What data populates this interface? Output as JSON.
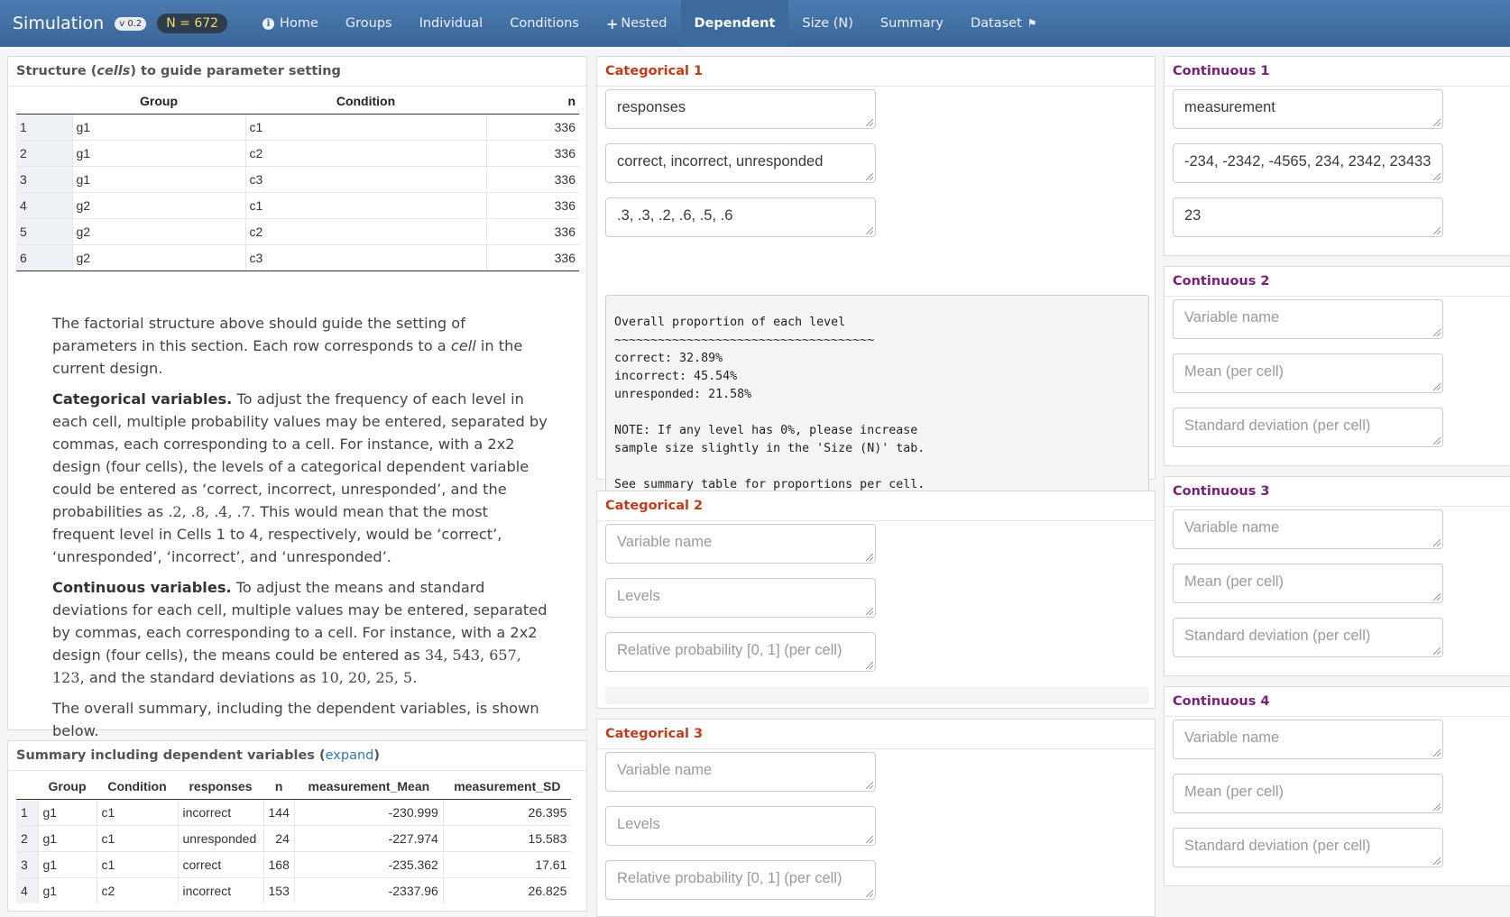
{
  "nav": {
    "brand": "Simulation",
    "version": "v 0.2",
    "n_badge": "N = 672",
    "items": [
      "Home",
      "Groups",
      "Individual",
      "Conditions",
      "Nested",
      "Dependent",
      "Size (N)",
      "Summary",
      "Dataset"
    ],
    "active": "Dependent"
  },
  "structure": {
    "title_pre": "Structure (",
    "title_em": "cells",
    "title_post": ") to guide parameter setting",
    "headers": [
      "Group",
      "Condition",
      "n"
    ],
    "rows": [
      [
        "1",
        "g1",
        "c1",
        "336"
      ],
      [
        "2",
        "g1",
        "c2",
        "336"
      ],
      [
        "3",
        "g1",
        "c3",
        "336"
      ],
      [
        "4",
        "g2",
        "c1",
        "336"
      ],
      [
        "5",
        "g2",
        "c2",
        "336"
      ],
      [
        "6",
        "g2",
        "c3",
        "336"
      ]
    ],
    "p1_a": "The factorial structure above should guide the setting of parameters in this section. Each row corresponds to a ",
    "p1_em": "cell",
    "p1_b": " in the current design.",
    "p2_bold": "Categorical variables.",
    "p2_a": " To adjust the frequency of each level in each cell, multiple probability values may be entered, separated by commas, each corresponding to a cell. For instance, with a 2x2 design (four cells), the levels of a categorical dependent variable could be entered as ‘correct, incorrect, unresponded’, and the probabilities as ",
    "p2_math": ".2, .8, .4, .7",
    "p2_b": ". This would mean that the most frequent level in Cells 1 to 4, respectively, would be ‘correct’, ‘unresponded’, ‘incorrect’, and ‘unresponded’.",
    "p3_bold": "Continuous variables.",
    "p3_a": " To adjust the means and standard deviations for each cell, multiple values may be entered, separated by commas, each corresponding to a cell. For instance, with a 2x2 design (four cells), the means could be entered as ",
    "p3_math1": "34, 543, 657, 123",
    "p3_b": ", and the standard deviations as ",
    "p3_math2": "10, 20, 25, 5",
    "p3_c": ".",
    "p4": "The overall summary, including the dependent variables, is shown below."
  },
  "summary": {
    "title": "Summary including dependent variables",
    "link_open": " (",
    "link": "expand",
    "link_close": ")",
    "headers": [
      "Group",
      "Condition",
      "responses",
      "n",
      "measurement_Mean",
      "measurement_SD"
    ],
    "rows": [
      [
        "1",
        "g1",
        "c1",
        "incorrect",
        "144",
        "-230.999",
        "26.395"
      ],
      [
        "2",
        "g1",
        "c1",
        "unresponded",
        "24",
        "-227.974",
        "15.583"
      ],
      [
        "3",
        "g1",
        "c1",
        "correct",
        "168",
        "-235.362",
        "17.61"
      ],
      [
        "4",
        "g1",
        "c2",
        "incorrect",
        "153",
        "-2337.96",
        "26.825"
      ]
    ]
  },
  "categorical": [
    {
      "title": "Categorical 1",
      "name": "responses",
      "levels": "correct, incorrect, unresponded",
      "probs": ".3, .3, .2, .6, .5, .6",
      "output": "Overall proportion of each level\n~~~~~~~~~~~~~~~~~~~~~~~~~~~~~~~~~~~~\ncorrect: 32.89%\nincorrect: 45.54%\nunresponded: 21.58%\n\nNOTE: If any level has 0%, please increase\nsample size slightly in the 'Size (N)' tab.\n\nSee summary table for proportions per cell.\n_"
    },
    {
      "title": "Categorical 2",
      "ph_name": "Variable name",
      "ph_levels": "Levels",
      "ph_probs": "Relative probability [0, 1] (per cell)"
    },
    {
      "title": "Categorical 3",
      "ph_name": "Variable name",
      "ph_levels": "Levels",
      "ph_probs": "Relative probability [0, 1] (per cell)"
    }
  ],
  "continuous": [
    {
      "title": "Continuous 1",
      "name": "measurement",
      "mean": "-234, -2342, -4565, 234, 2342, 23433",
      "sd": "23"
    },
    {
      "title": "Continuous 2",
      "ph_name": "Variable name",
      "ph_mean": "Mean (per cell)",
      "ph_sd": "Standard deviation (per cell)"
    },
    {
      "title": "Continuous 3",
      "ph_name": "Variable name",
      "ph_mean": "Mean (per cell)",
      "ph_sd": "Standard deviation (per cell)"
    },
    {
      "title": "Continuous 4",
      "ph_name": "Variable name",
      "ph_mean": "Mean (per cell)",
      "ph_sd": "Standard deviation (per cell)"
    }
  ]
}
